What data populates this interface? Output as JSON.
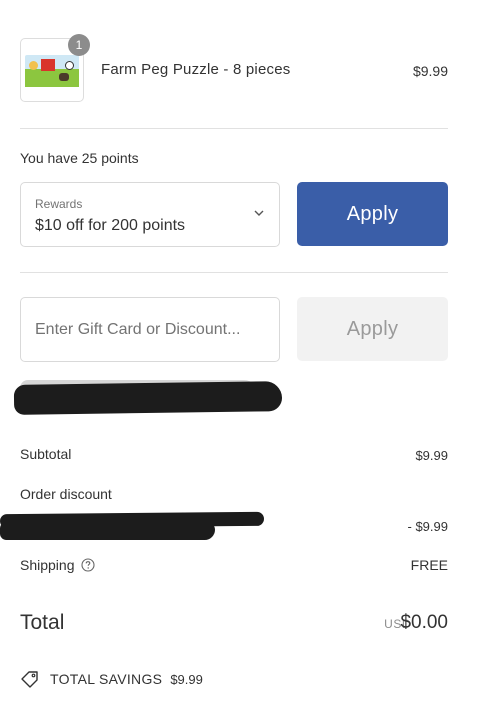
{
  "product": {
    "quantity": "1",
    "name": "Farm Peg Puzzle - 8 pieces",
    "price": "$9.99",
    "thumbnail_icon": "farm-puzzle-image"
  },
  "rewards": {
    "points_text": "You have 25 points",
    "select_label": "Rewards",
    "select_value": "$10 off for 200 points",
    "apply_label": "Apply",
    "apply_color": "#3a5ea8"
  },
  "gift_card": {
    "placeholder": "Enter Gift Card or Discount...",
    "apply_label": "Apply"
  },
  "summary": {
    "subtotal_label": "Subtotal",
    "subtotal_value": "$9.99",
    "discount_label": "Order discount",
    "discount_value": "- $9.99",
    "shipping_label": "Shipping",
    "shipping_value": "FREE",
    "total_label": "Total",
    "total_currency": "USD",
    "total_value": "$0.00",
    "savings_label": "TOTAL SAVINGS",
    "savings_value": "$9.99"
  }
}
